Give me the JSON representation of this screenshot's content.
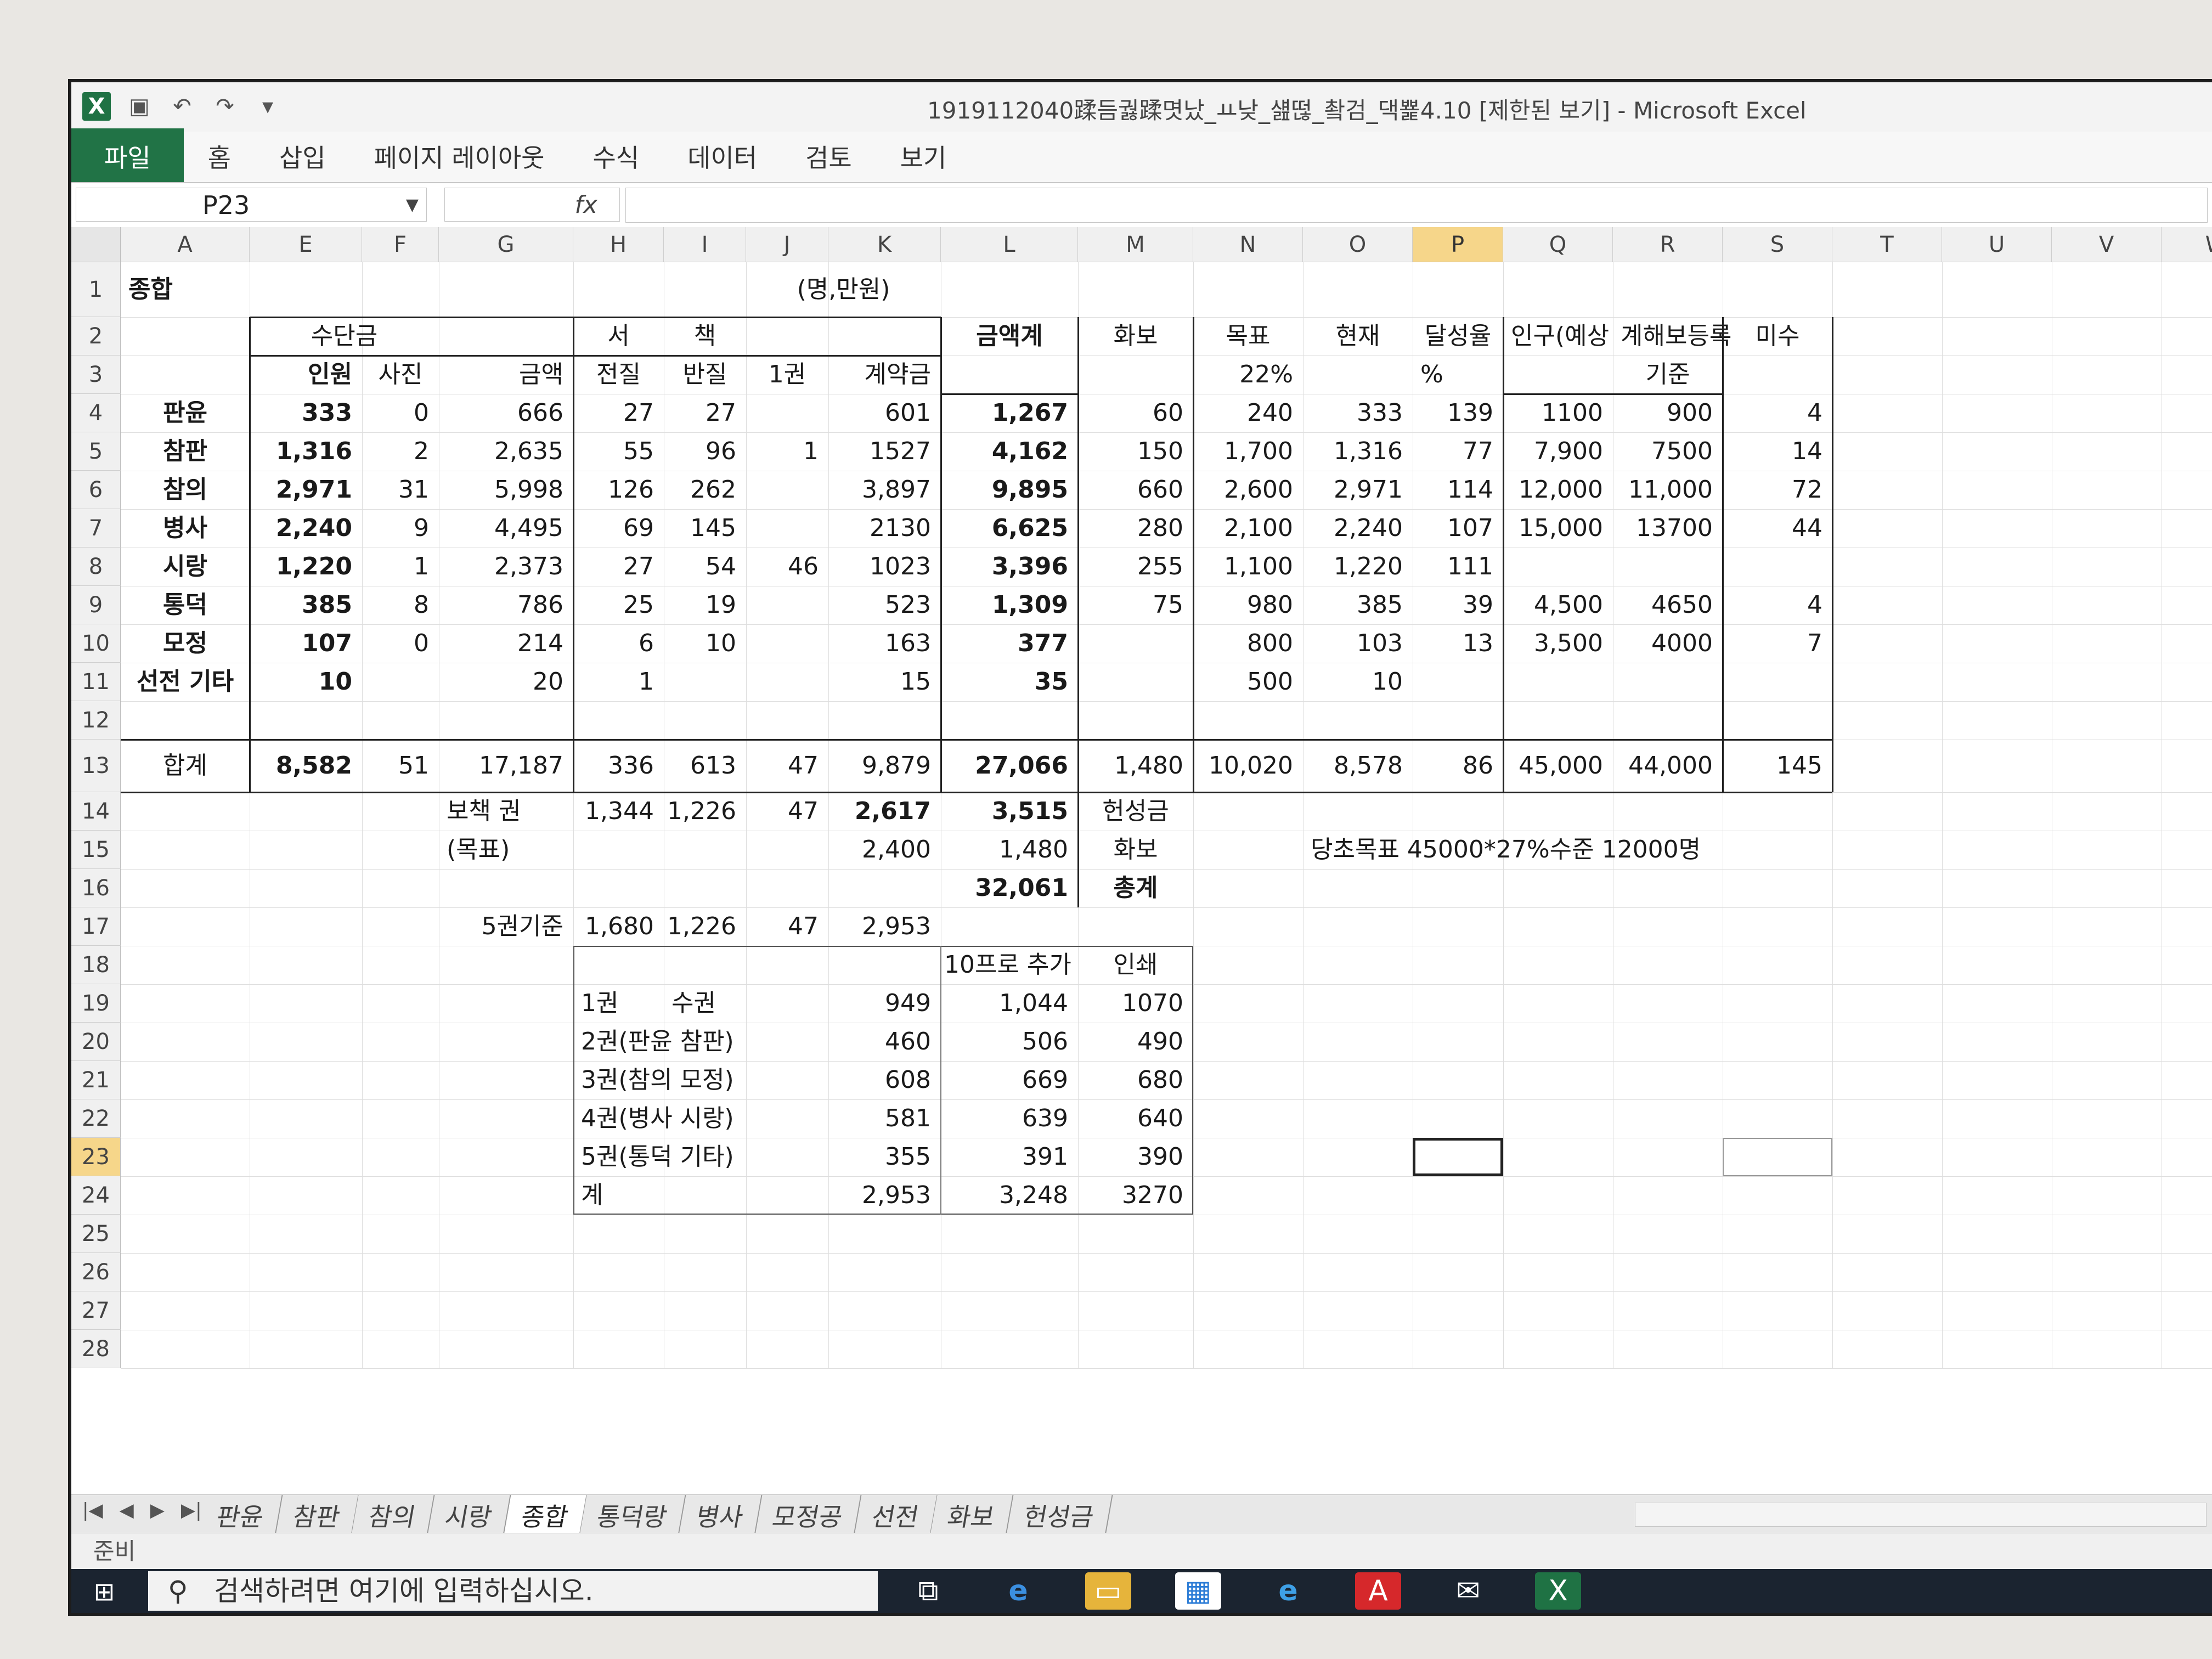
{
  "window": {
    "title": "1919112040蹂듬궗蹂몃났_ㅛ낮_섎떦_촼검_댁뾽4.10 [제한된 보기] - Microsoft Excel"
  },
  "ribbon": {
    "tabs": [
      "파일",
      "홈",
      "삽입",
      "페이지 레이아웃",
      "수식",
      "데이터",
      "검토",
      "보기"
    ]
  },
  "formula_bar": {
    "name_box": "P23",
    "fx": "fx",
    "value": ""
  },
  "columns": [
    "A",
    "E",
    "F",
    "G",
    "H",
    "I",
    "J",
    "K",
    "L",
    "M",
    "N",
    "O",
    "P",
    "Q",
    "R",
    "S",
    "T",
    "U",
    "V",
    "W"
  ],
  "rows": [
    "1",
    "2",
    "3",
    "4",
    "5",
    "6",
    "7",
    "8",
    "9",
    "10",
    "11",
    "12",
    "13",
    "14",
    "15",
    "16",
    "17",
    "18",
    "19",
    "20",
    "21",
    "22",
    "23",
    "24",
    "25",
    "26",
    "27",
    "28"
  ],
  "sheet": {
    "title": "종합",
    "unit": "(명,만원)",
    "h_sudangeum": "수단금",
    "h_seo": "서",
    "h_chaek": "책",
    "h_geumaekgye": "금액계",
    "h_hwabo": "화보",
    "h_mokpyo": "목표",
    "h_hyeonjae": "현재",
    "h_dalseong": "달성율",
    "h_ingu": "인구(예상",
    "h_gyehae": "계해보등록",
    "h_misu": "미수",
    "h_inwon": "인원",
    "h_saji": "사진",
    "h_geumaek": "금액",
    "h_jeonjil": "전질",
    "h_banjil": "반질",
    "h_1gwon": "1권",
    "h_gyeyak": "계약금",
    "h_22": "22%",
    "h_pct": "%",
    "h_gijun": "기준",
    "rows": [
      {
        "name": "판윤",
        "E": "333",
        "F": "0",
        "G": "666",
        "H": "27",
        "I": "27",
        "J": "",
        "K": "601",
        "L": "1,267",
        "M": "60",
        "N": "240",
        "O": "333",
        "P": "139",
        "Q": "1100",
        "R": "900",
        "S": "4"
      },
      {
        "name": "참판",
        "E": "1,316",
        "F": "2",
        "G": "2,635",
        "H": "55",
        "I": "96",
        "J": "1",
        "K": "1527",
        "L": "4,162",
        "M": "150",
        "N": "1,700",
        "O": "1,316",
        "P": "77",
        "Q": "7,900",
        "R": "7500",
        "S": "14"
      },
      {
        "name": "참의",
        "E": "2,971",
        "F": "31",
        "G": "5,998",
        "H": "126",
        "I": "262",
        "J": "",
        "K": "3,897",
        "L": "9,895",
        "M": "660",
        "N": "2,600",
        "O": "2,971",
        "P": "114",
        "Q": "12,000",
        "R": "11,000",
        "S": "72"
      },
      {
        "name": "병사",
        "E": "2,240",
        "F": "9",
        "G": "4,495",
        "H": "69",
        "I": "145",
        "J": "",
        "K": "2130",
        "L": "6,625",
        "M": "280",
        "N": "2,100",
        "O": "2,240",
        "P": "107",
        "Q": "15,000",
        "R": "13700",
        "S": "44"
      },
      {
        "name": "시랑",
        "E": "1,220",
        "F": "1",
        "G": "2,373",
        "H": "27",
        "I": "54",
        "J": "46",
        "K": "1023",
        "L": "3,396",
        "M": "255",
        "N": "1,100",
        "O": "1,220",
        "P": "111",
        "Q": "",
        "R": "",
        "S": ""
      },
      {
        "name": "통덕",
        "E": "385",
        "F": "8",
        "G": "786",
        "H": "25",
        "I": "19",
        "J": "",
        "K": "523",
        "L": "1,309",
        "M": "75",
        "N": "980",
        "O": "385",
        "P": "39",
        "Q": "4,500",
        "R": "4650",
        "S": "4"
      },
      {
        "name": "모정",
        "E": "107",
        "F": "0",
        "G": "214",
        "H": "6",
        "I": "10",
        "J": "",
        "K": "163",
        "L": "377",
        "M": "",
        "N": "800",
        "O": "103",
        "P": "13",
        "Q": "3,500",
        "R": "4000",
        "S": "7"
      },
      {
        "name": "선전 기타",
        "E": "10",
        "F": "",
        "G": "20",
        "H": "1",
        "I": "",
        "J": "",
        "K": "15",
        "L": "35",
        "M": "",
        "N": "500",
        "O": "10",
        "P": "",
        "Q": "",
        "R": "",
        "S": ""
      }
    ],
    "total": {
      "name": "합계",
      "E": "8,582",
      "F": "51",
      "G": "17,187",
      "H": "336",
      "I": "613",
      "J": "47",
      "K": "9,879",
      "L": "27,066",
      "M": "1,480",
      "N": "10,020",
      "O": "8,578",
      "P": "86",
      "Q": "45,000",
      "R": "44,000",
      "S": "145"
    },
    "r14": {
      "label": "보책 권",
      "H": "1,344",
      "I": "1,226",
      "J": "47",
      "K": "2,617",
      "L": "3,515",
      "M": "헌성금"
    },
    "r15": {
      "label": "(목표)",
      "K": "2,400",
      "L": "1,480",
      "M": "화보",
      "note": "당초목표 45000*27%수준 12000명"
    },
    "r16": {
      "L": "32,061",
      "M": "총계"
    },
    "r17": {
      "label": "5권기준",
      "H": "1,680",
      "I": "1,226",
      "J": "47",
      "K": "2,953"
    },
    "sub_header": {
      "L": "10프로 추가",
      "M": "인쇄"
    },
    "sub_rows": [
      {
        "name": "1권",
        "sub": "수권",
        "K": "949",
        "L": "1,044",
        "M": "1070"
      },
      {
        "name": "2권(판윤 참판)",
        "sub": "",
        "K": "460",
        "L": "506",
        "M": "490"
      },
      {
        "name": "3권(참의 모정)",
        "sub": "",
        "K": "608",
        "L": "669",
        "M": "680"
      },
      {
        "name": "4권(병사 시랑)",
        "sub": "",
        "K": "581",
        "L": "639",
        "M": "640"
      },
      {
        "name": "5권(통덕 기타)",
        "sub": "",
        "K": "355",
        "L": "391",
        "M": "390"
      },
      {
        "name": "계",
        "sub": "",
        "K": "2,953",
        "L": "3,248",
        "M": "3270"
      }
    ]
  },
  "sheet_tabs": [
    "판윤",
    "참판",
    "참의",
    "시랑",
    "종합",
    "통덕랑",
    "병사",
    "모정공",
    "선전",
    "화보",
    "헌성금"
  ],
  "active_tab": "종합",
  "status": "준비",
  "taskbar": {
    "search_placeholder": "검색하려면 여기에 입력하십시오.",
    "icons": [
      "task-view-icon",
      "edge-icon",
      "file-explorer-icon",
      "store-icon",
      "ie-icon",
      "acrobat-icon",
      "mail-icon",
      "excel-icon"
    ]
  }
}
